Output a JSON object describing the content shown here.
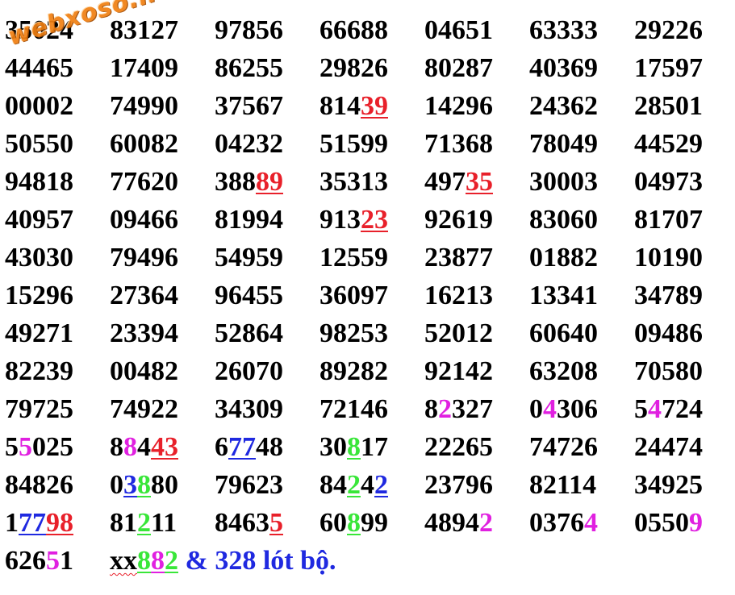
{
  "watermark": "webxoso.net",
  "colors": {
    "red": "#e8202a",
    "magenta": "#e020e0",
    "green": "#39e639",
    "blue": "#1f29e0",
    "orange_watermark": "#f07f12"
  },
  "rows": [
    [
      [
        {
          "t": "35024"
        }
      ],
      [
        {
          "t": "83127"
        }
      ],
      [
        {
          "t": "97856"
        }
      ],
      [
        {
          "t": "66688"
        }
      ],
      [
        {
          "t": "04651"
        }
      ],
      [
        {
          "t": "63333"
        }
      ],
      [
        {
          "t": "29226"
        }
      ]
    ],
    [
      [
        {
          "t": "44465"
        }
      ],
      [
        {
          "t": "17409"
        }
      ],
      [
        {
          "t": "86255"
        }
      ],
      [
        {
          "t": "29826"
        }
      ],
      [
        {
          "t": "80287"
        }
      ],
      [
        {
          "t": "40369"
        }
      ],
      [
        {
          "t": "17597"
        }
      ]
    ],
    [
      [
        {
          "t": "00002"
        }
      ],
      [
        {
          "t": "74990"
        }
      ],
      [
        {
          "t": "37567"
        }
      ],
      [
        {
          "t": "814"
        },
        {
          "t": "39",
          "c": "red",
          "u": true
        }
      ],
      [
        {
          "t": "14296"
        }
      ],
      [
        {
          "t": "24362"
        }
      ],
      [
        {
          "t": "28501"
        }
      ]
    ],
    [
      [
        {
          "t": "50550"
        }
      ],
      [
        {
          "t": "60082"
        }
      ],
      [
        {
          "t": "04232"
        }
      ],
      [
        {
          "t": "51599"
        }
      ],
      [
        {
          "t": "71368"
        }
      ],
      [
        {
          "t": "78049"
        }
      ],
      [
        {
          "t": "44529"
        }
      ]
    ],
    [
      [
        {
          "t": "94818"
        }
      ],
      [
        {
          "t": "77620"
        }
      ],
      [
        {
          "t": "388"
        },
        {
          "t": "89",
          "c": "red",
          "u": true
        }
      ],
      [
        {
          "t": "35313"
        }
      ],
      [
        {
          "t": "497"
        },
        {
          "t": "35",
          "c": "red",
          "u": true
        }
      ],
      [
        {
          "t": "30003"
        }
      ],
      [
        {
          "t": "04973"
        }
      ]
    ],
    [
      [
        {
          "t": "40957"
        }
      ],
      [
        {
          "t": "09466"
        }
      ],
      [
        {
          "t": "81994"
        }
      ],
      [
        {
          "t": "913"
        },
        {
          "t": "23",
          "c": "red",
          "u": true
        }
      ],
      [
        {
          "t": "92619"
        }
      ],
      [
        {
          "t": "83060"
        }
      ],
      [
        {
          "t": "81707"
        }
      ]
    ],
    [
      [
        {
          "t": "43030"
        }
      ],
      [
        {
          "t": "79496"
        }
      ],
      [
        {
          "t": "54959"
        }
      ],
      [
        {
          "t": "12559"
        }
      ],
      [
        {
          "t": "23877"
        }
      ],
      [
        {
          "t": "01882"
        }
      ],
      [
        {
          "t": "10190"
        }
      ]
    ],
    [
      [
        {
          "t": "15296"
        }
      ],
      [
        {
          "t": "27364"
        }
      ],
      [
        {
          "t": "96455"
        }
      ],
      [
        {
          "t": "36097"
        }
      ],
      [
        {
          "t": "16213"
        }
      ],
      [
        {
          "t": "13341"
        }
      ],
      [
        {
          "t": "34789"
        }
      ]
    ],
    [
      [
        {
          "t": "49271"
        }
      ],
      [
        {
          "t": "23394"
        }
      ],
      [
        {
          "t": "52864"
        }
      ],
      [
        {
          "t": "98253"
        }
      ],
      [
        {
          "t": "52012"
        }
      ],
      [
        {
          "t": "60640"
        }
      ],
      [
        {
          "t": "09486"
        }
      ]
    ],
    [
      [
        {
          "t": "82239"
        }
      ],
      [
        {
          "t": "00482"
        }
      ],
      [
        {
          "t": "26070"
        }
      ],
      [
        {
          "t": "89282"
        }
      ],
      [
        {
          "t": "92142"
        }
      ],
      [
        {
          "t": "63208"
        }
      ],
      [
        {
          "t": "70580"
        }
      ]
    ],
    [
      [
        {
          "t": "79725"
        }
      ],
      [
        {
          "t": "74922"
        }
      ],
      [
        {
          "t": "34309"
        }
      ],
      [
        {
          "t": "72146"
        }
      ],
      [
        {
          "t": "8"
        },
        {
          "t": "2",
          "c": "magenta"
        },
        {
          "t": "327"
        }
      ],
      [
        {
          "t": "0"
        },
        {
          "t": "4",
          "c": "magenta"
        },
        {
          "t": "306"
        }
      ],
      [
        {
          "t": "5"
        },
        {
          "t": "4",
          "c": "magenta"
        },
        {
          "t": "724"
        }
      ]
    ],
    [
      [
        {
          "t": "5"
        },
        {
          "t": "5",
          "c": "magenta"
        },
        {
          "t": "025"
        }
      ],
      [
        {
          "t": "8"
        },
        {
          "t": "8",
          "c": "magenta"
        },
        {
          "t": "4"
        },
        {
          "t": "43",
          "c": "red",
          "u": true
        }
      ],
      [
        {
          "t": "6"
        },
        {
          "t": "77",
          "c": "blue",
          "u": true
        },
        {
          "t": "48"
        }
      ],
      [
        {
          "t": "30"
        },
        {
          "t": "8",
          "c": "green",
          "u": true
        },
        {
          "t": "17"
        }
      ],
      [
        {
          "t": "22265"
        }
      ],
      [
        {
          "t": "74726"
        }
      ],
      [
        {
          "t": "24474"
        }
      ]
    ],
    [
      [
        {
          "t": "84826"
        }
      ],
      [
        {
          "t": "0"
        },
        {
          "t": "3",
          "c": "blue",
          "u": true
        },
        {
          "t": "8",
          "c": "green",
          "u": true
        },
        {
          "t": "80"
        }
      ],
      [
        {
          "t": "79623"
        }
      ],
      [
        {
          "t": "84"
        },
        {
          "t": "2",
          "c": "green",
          "u": true
        },
        {
          "t": "4"
        },
        {
          "t": "2",
          "c": "blue",
          "u": true
        }
      ],
      [
        {
          "t": "23796"
        }
      ],
      [
        {
          "t": "82114"
        }
      ],
      [
        {
          "t": "34925"
        }
      ]
    ],
    [
      [
        {
          "t": "1"
        },
        {
          "t": "77",
          "c": "blue",
          "u": true
        },
        {
          "t": "98",
          "c": "red",
          "u": true
        }
      ],
      [
        {
          "t": "81"
        },
        {
          "t": "2",
          "c": "green",
          "u": true
        },
        {
          "t": "11"
        }
      ],
      [
        {
          "t": "8463"
        },
        {
          "t": "5",
          "c": "red",
          "u": true
        }
      ],
      [
        {
          "t": "60"
        },
        {
          "t": "8",
          "c": "green",
          "u": true
        },
        {
          "t": "99"
        }
      ],
      [
        {
          "t": "4894"
        },
        {
          "t": "2",
          "c": "magenta"
        }
      ],
      [
        {
          "t": "0376"
        },
        {
          "t": "4",
          "c": "magenta"
        }
      ],
      [
        {
          "t": "0550"
        },
        {
          "t": "9",
          "c": "magenta"
        }
      ]
    ]
  ],
  "footer": {
    "first_prefix": "626",
    "first_mag": "5",
    "first_suffix": "1",
    "xx": "xx",
    "g1": "8",
    "g2": "8",
    "g3": "2",
    "rest": " & 328 lót bộ."
  }
}
